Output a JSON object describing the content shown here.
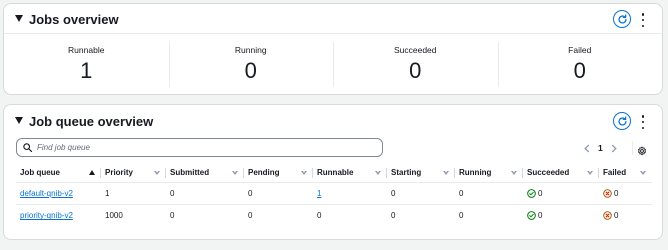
{
  "jobs_overview": {
    "title": "Jobs overview",
    "stats": [
      {
        "label": "Runnable",
        "value": "1"
      },
      {
        "label": "Running",
        "value": "0"
      },
      {
        "label": "Succeeded",
        "value": "0"
      },
      {
        "label": "Failed",
        "value": "0"
      }
    ]
  },
  "queue_overview": {
    "title": "Job queue overview",
    "search": {
      "placeholder": "Find job queue",
      "value": ""
    },
    "pagination": {
      "current_page": "1"
    },
    "columns": [
      "Job queue",
      "Priority",
      "Submitted",
      "Pending",
      "Runnable",
      "Starting",
      "Running",
      "Succeeded",
      "Failed"
    ],
    "rows": [
      {
        "job_queue": "default-qnib-v2",
        "priority": "1",
        "submitted": "0",
        "pending": "0",
        "runnable": "1",
        "starting": "0",
        "running": "0",
        "succeeded": "0",
        "failed": "0"
      },
      {
        "job_queue": "priority-qnib-v2",
        "priority": "1000",
        "submitted": "0",
        "pending": "0",
        "runnable": "0",
        "starting": "0",
        "running": "0",
        "succeeded": "0",
        "failed": "0"
      }
    ]
  },
  "colors": {
    "link": "#0972d3",
    "success": "#037f0c",
    "error": "#d91515",
    "border": "#d5dbdb"
  },
  "icons": {
    "refresh": "refresh-icon",
    "more": "kebab-menu-icon",
    "search": "search-icon",
    "settings": "gear-icon",
    "success": "check-circle-icon",
    "error": "x-circle-icon"
  }
}
